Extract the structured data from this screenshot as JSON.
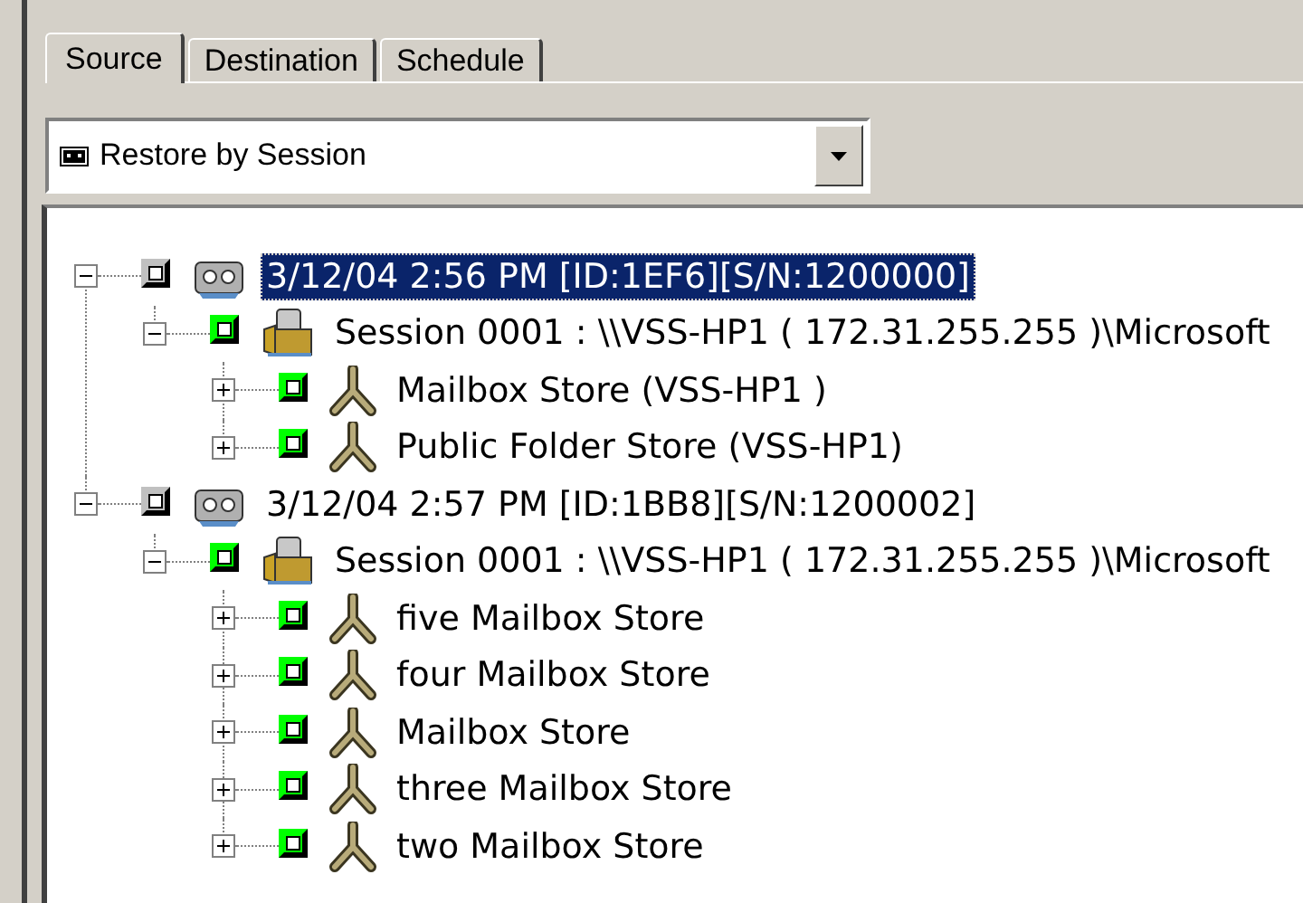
{
  "tabs": [
    {
      "label": "Source",
      "selected": true
    },
    {
      "label": "Destination",
      "selected": false
    },
    {
      "label": "Schedule",
      "selected": false
    }
  ],
  "view_select": {
    "value": "Restore by Session"
  },
  "tree": [
    {
      "kind": "session-group",
      "label": "3/12/04 2:56 PM [ID:1EF6][S/N:1200000]",
      "checked": false,
      "expanded": true,
      "selected": true,
      "children": [
        {
          "kind": "session",
          "label": "Session 0001 : \\\\VSS-HP1  ( 172.31.255.255 )\\Microsoft",
          "checked": true,
          "expanded": true,
          "selected": false,
          "children": [
            {
              "kind": "store",
              "label": "Mailbox Store (VSS-HP1  )",
              "checked": true,
              "expanded": false,
              "selected": false
            },
            {
              "kind": "store",
              "label": "Public Folder Store (VSS-HP1)",
              "checked": true,
              "expanded": false,
              "selected": false
            }
          ]
        }
      ]
    },
    {
      "kind": "session-group",
      "label": "3/12/04 2:57 PM [ID:1BB8][S/N:1200002]",
      "checked": false,
      "expanded": true,
      "selected": false,
      "children": [
        {
          "kind": "session",
          "label": "Session 0001 : \\\\VSS-HP1  ( 172.31.255.255 )\\Microsoft",
          "checked": true,
          "expanded": true,
          "selected": false,
          "children": [
            {
              "kind": "store",
              "label": "five Mailbox Store",
              "checked": true,
              "expanded": false,
              "selected": false
            },
            {
              "kind": "store",
              "label": "four Mailbox Store",
              "checked": true,
              "expanded": false,
              "selected": false
            },
            {
              "kind": "store",
              "label": "Mailbox Store",
              "checked": true,
              "expanded": false,
              "selected": false
            },
            {
              "kind": "store",
              "label": "three Mailbox Store",
              "checked": true,
              "expanded": false,
              "selected": false
            },
            {
              "kind": "store",
              "label": "two Mailbox Store",
              "checked": true,
              "expanded": false,
              "selected": false
            }
          ]
        }
      ]
    }
  ]
}
